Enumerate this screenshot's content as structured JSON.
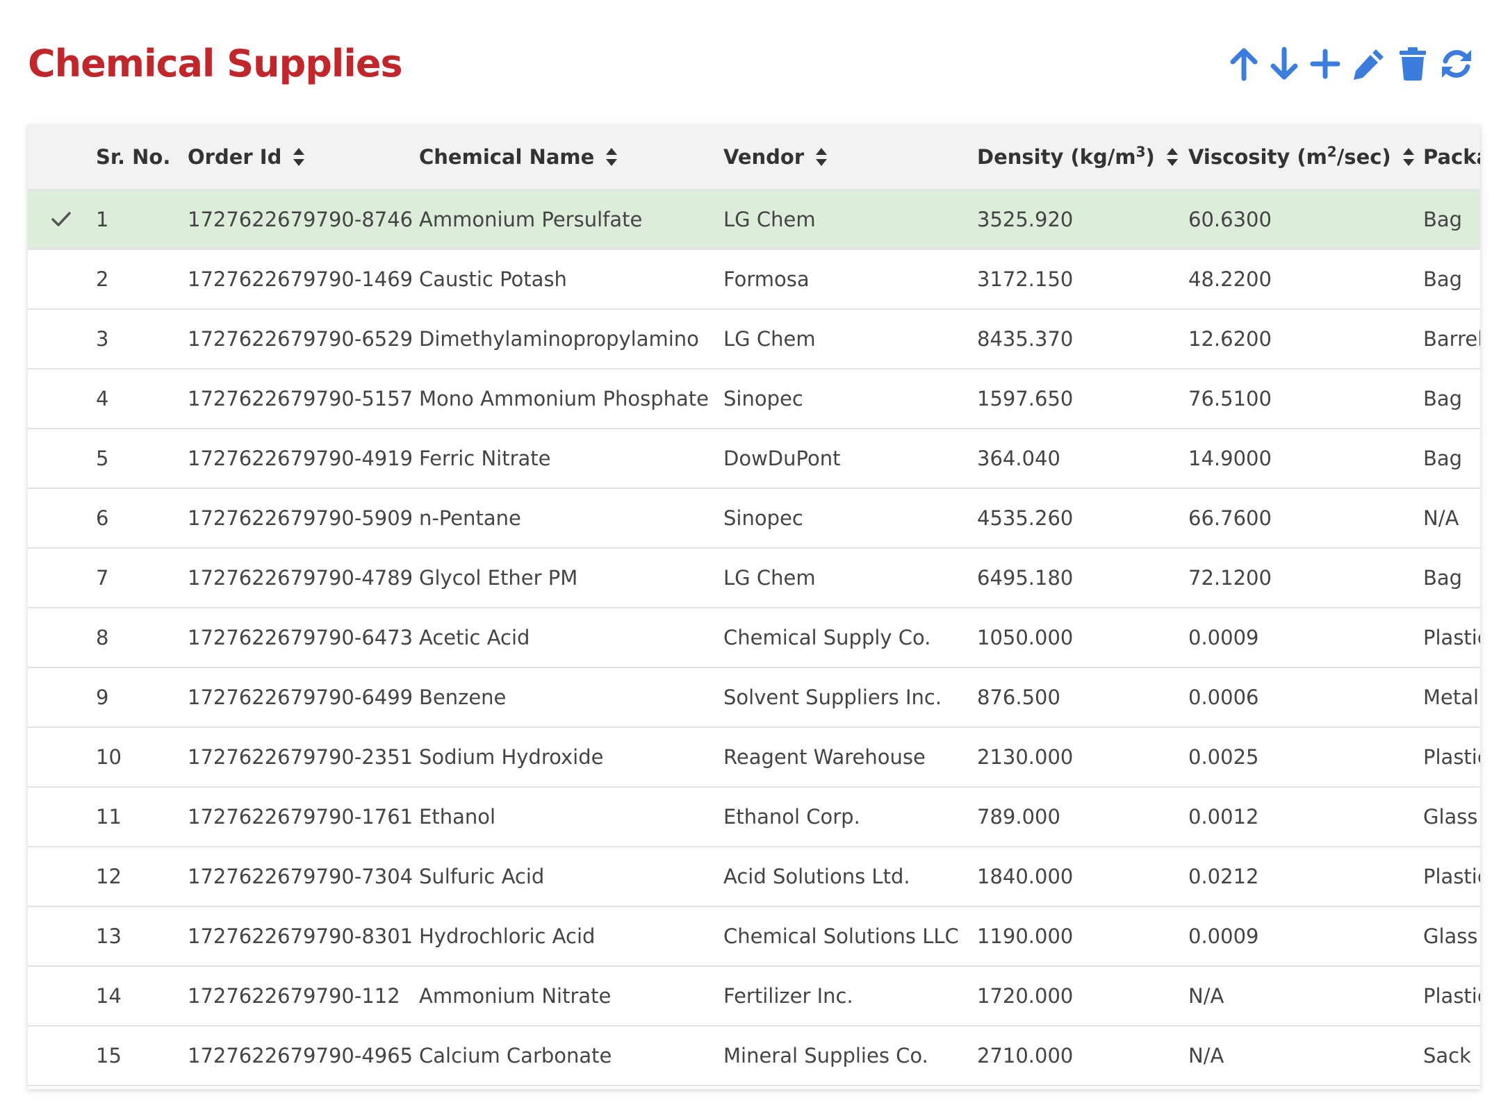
{
  "page": {
    "title": "Chemical Supplies"
  },
  "toolbar": {
    "color": "#3b7ddd",
    "buttons": [
      {
        "icon": "arrow-up-icon"
      },
      {
        "icon": "arrow-down-icon"
      },
      {
        "icon": "plus-icon"
      },
      {
        "icon": "pencil-icon"
      },
      {
        "icon": "trash-icon"
      },
      {
        "icon": "refresh-icon"
      }
    ]
  },
  "grid": {
    "selected_row_color": "#dcedd9",
    "columns": {
      "sr_no": "Sr. No.",
      "order_id": "Order Id",
      "chemical_name": "Chemical Name",
      "vendor": "Vendor",
      "density_prefix": "Density (kg/m",
      "density_sup": "3",
      "density_suffix": ")",
      "viscosity_prefix": "Viscosity (m",
      "viscosity_sup": "2",
      "viscosity_suffix": "/sec)",
      "packaging": "Packa"
    },
    "selected_index": 0,
    "rows": [
      {
        "sr": "1",
        "order_id": "1727622679790-8746",
        "chemical": "Ammonium Persulfate",
        "vendor": "LG Chem",
        "density": "3525.920",
        "viscosity": "60.6300",
        "packaging": "Bag"
      },
      {
        "sr": "2",
        "order_id": "1727622679790-1469",
        "chemical": "Caustic Potash",
        "vendor": "Formosa",
        "density": "3172.150",
        "viscosity": "48.2200",
        "packaging": "Bag"
      },
      {
        "sr": "3",
        "order_id": "1727622679790-6529",
        "chemical": "Dimethylaminopropylamino",
        "vendor": "LG Chem",
        "density": "8435.370",
        "viscosity": "12.6200",
        "packaging": "Barrel"
      },
      {
        "sr": "4",
        "order_id": "1727622679790-5157",
        "chemical": "Mono Ammonium Phosphate",
        "vendor": "Sinopec",
        "density": "1597.650",
        "viscosity": "76.5100",
        "packaging": "Bag"
      },
      {
        "sr": "5",
        "order_id": "1727622679790-4919",
        "chemical": "Ferric Nitrate",
        "vendor": "DowDuPont",
        "density": "364.040",
        "viscosity": "14.9000",
        "packaging": "Bag"
      },
      {
        "sr": "6",
        "order_id": "1727622679790-5909",
        "chemical": "n-Pentane",
        "vendor": "Sinopec",
        "density": "4535.260",
        "viscosity": "66.7600",
        "packaging": "N/A"
      },
      {
        "sr": "7",
        "order_id": "1727622679790-4789",
        "chemical": "Glycol Ether PM",
        "vendor": "LG Chem",
        "density": "6495.180",
        "viscosity": "72.1200",
        "packaging": "Bag"
      },
      {
        "sr": "8",
        "order_id": "1727622679790-6473",
        "chemical": "Acetic Acid",
        "vendor": "Chemical Supply Co.",
        "density": "1050.000",
        "viscosity": "0.0009",
        "packaging": "Plastic"
      },
      {
        "sr": "9",
        "order_id": "1727622679790-6499",
        "chemical": "Benzene",
        "vendor": "Solvent Suppliers Inc.",
        "density": "876.500",
        "viscosity": "0.0006",
        "packaging": "Metal"
      },
      {
        "sr": "10",
        "order_id": "1727622679790-2351",
        "chemical": "Sodium Hydroxide",
        "vendor": "Reagent Warehouse",
        "density": "2130.000",
        "viscosity": "0.0025",
        "packaging": "Plastic"
      },
      {
        "sr": "11",
        "order_id": "1727622679790-1761",
        "chemical": "Ethanol",
        "vendor": "Ethanol Corp.",
        "density": "789.000",
        "viscosity": "0.0012",
        "packaging": "Glass"
      },
      {
        "sr": "12",
        "order_id": "1727622679790-7304",
        "chemical": "Sulfuric Acid",
        "vendor": "Acid Solutions Ltd.",
        "density": "1840.000",
        "viscosity": "0.0212",
        "packaging": "Plastic"
      },
      {
        "sr": "13",
        "order_id": "1727622679790-8301",
        "chemical": "Hydrochloric Acid",
        "vendor": "Chemical Solutions LLC",
        "density": "1190.000",
        "viscosity": "0.0009",
        "packaging": "Glass"
      },
      {
        "sr": "14",
        "order_id": "1727622679790-112",
        "chemical": "Ammonium Nitrate",
        "vendor": "Fertilizer Inc.",
        "density": "1720.000",
        "viscosity": "N/A",
        "packaging": "Plastic"
      },
      {
        "sr": "15",
        "order_id": "1727622679790-4965",
        "chemical": "Calcium Carbonate",
        "vendor": "Mineral Supplies Co.",
        "density": "2710.000",
        "viscosity": "N/A",
        "packaging": "Sack"
      }
    ]
  }
}
